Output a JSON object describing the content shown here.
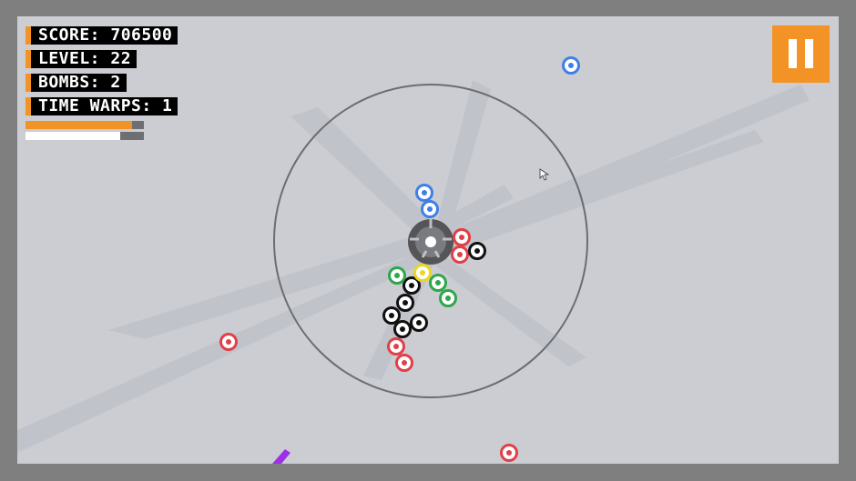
{
  "hud": {
    "score_label": "SCORE: 706500",
    "level_label": "LEVEL: 22",
    "bombs_label": "BOMBS: 2",
    "time_warps_label": "TIME WARPS: 1",
    "progress_bar_1_fraction": 0.9,
    "progress_bar_2_fraction": 0.8
  },
  "pause_button": {
    "icon": "pause-icon"
  },
  "colors": {
    "accent": "#f39325",
    "background": "#cbcdd3",
    "frame": "#7f7f7f",
    "orb_blue": "#3f7fe8",
    "orb_red": "#e04048",
    "orb_green": "#2ea64a",
    "orb_yellow": "#e8d820",
    "orb_black": "#111111",
    "orb_purple": "#9b30e8"
  },
  "orbs": [
    {
      "color": "blue"
    },
    {
      "color": "blue"
    },
    {
      "color": "blue"
    },
    {
      "color": "red"
    },
    {
      "color": "red"
    },
    {
      "color": "red"
    },
    {
      "color": "red"
    },
    {
      "color": "red"
    },
    {
      "color": "red"
    },
    {
      "color": "red"
    },
    {
      "color": "black"
    },
    {
      "color": "black"
    },
    {
      "color": "black"
    },
    {
      "color": "black"
    },
    {
      "color": "black"
    },
    {
      "color": "black"
    },
    {
      "color": "green"
    },
    {
      "color": "green"
    },
    {
      "color": "green"
    },
    {
      "color": "yellow"
    }
  ]
}
